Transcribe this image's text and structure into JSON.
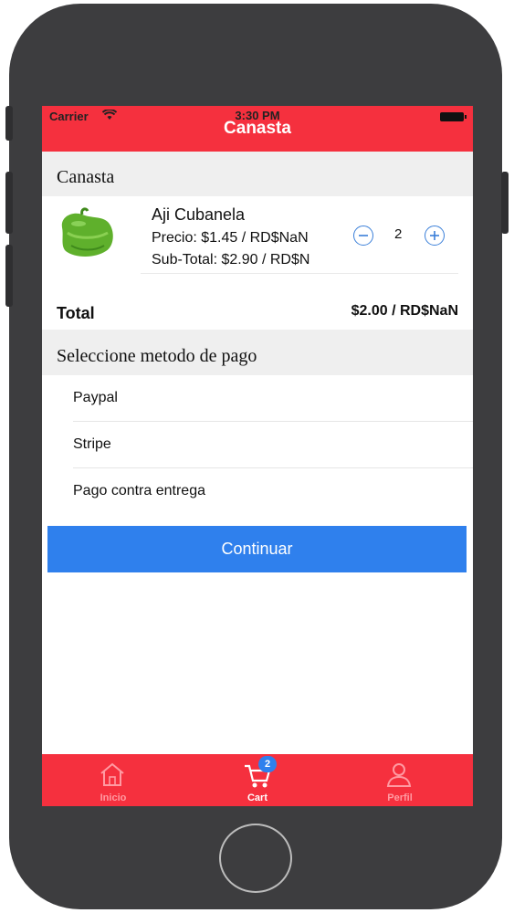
{
  "status_bar": {
    "carrier": "Carrier",
    "time": "3:30 PM"
  },
  "nav": {
    "title": "Canasta"
  },
  "cart": {
    "section_title": "Canasta",
    "items": [
      {
        "name": "Aji Cubanela",
        "price": "Precio: $1.45 / RD$NaN",
        "subtotal": "Sub-Total: $2.90 / RD$N",
        "quantity": "2"
      }
    ],
    "total_label": "Total",
    "total_value": "$2.00 / RD$NaN"
  },
  "payment": {
    "section_title": "Seleccione metodo de pago",
    "options": [
      "Paypal",
      "Stripe",
      "Pago contra entrega"
    ]
  },
  "continue_label": "Continuar",
  "tabbar": {
    "tabs": [
      {
        "label": "Inicio",
        "icon": "home-icon"
      },
      {
        "label": "Cart",
        "icon": "cart-icon",
        "badge": "2"
      },
      {
        "label": "Perfil",
        "icon": "user-icon"
      }
    ]
  },
  "colors": {
    "brand_red": "#f5303e",
    "accent_blue": "#2f80ed",
    "phone_body": "#3d3d3f"
  }
}
